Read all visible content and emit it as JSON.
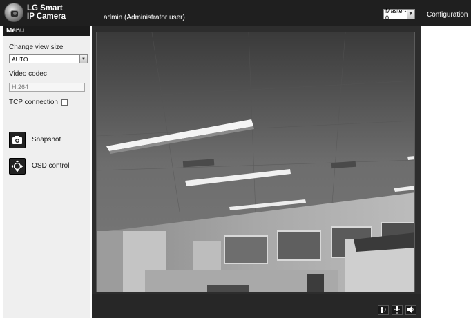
{
  "header": {
    "brand_line1": "LG Smart",
    "brand_line2": "IP Camera",
    "user": "admin (Administrator user)",
    "stream_select": "Master-0",
    "configuration_label": "Configuration",
    "logo_icon": "camera-logo-icon"
  },
  "sidebar": {
    "menu_title": "Menu",
    "view_size_label": "Change view size",
    "view_size_value": "AUTO",
    "codec_label": "Video codec",
    "codec_value": "H.264",
    "tcp_label": "TCP connection",
    "tcp_checked": false,
    "snapshot_label": "Snapshot",
    "snapshot_icon": "camera-icon",
    "osd_label": "OSD control",
    "osd_icon": "dpad-icon"
  },
  "viewer": {
    "controls": [
      {
        "name": "speaker-icon"
      },
      {
        "name": "microphone-icon"
      },
      {
        "name": "volume-icon"
      }
    ]
  }
}
